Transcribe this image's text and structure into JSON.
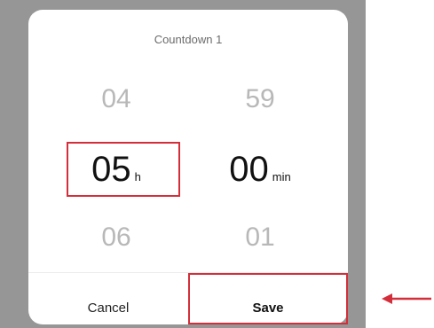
{
  "dialog": {
    "title": "Countdown 1"
  },
  "picker": {
    "hours": {
      "above": "04",
      "selected": "05",
      "below": "06",
      "unit": "h"
    },
    "minutes": {
      "above": "59",
      "selected": "00",
      "below": "01",
      "unit": "min"
    }
  },
  "actions": {
    "cancel_label": "Cancel",
    "save_label": "Save"
  },
  "annotations": {
    "highlight_color": "#d32f3a"
  }
}
